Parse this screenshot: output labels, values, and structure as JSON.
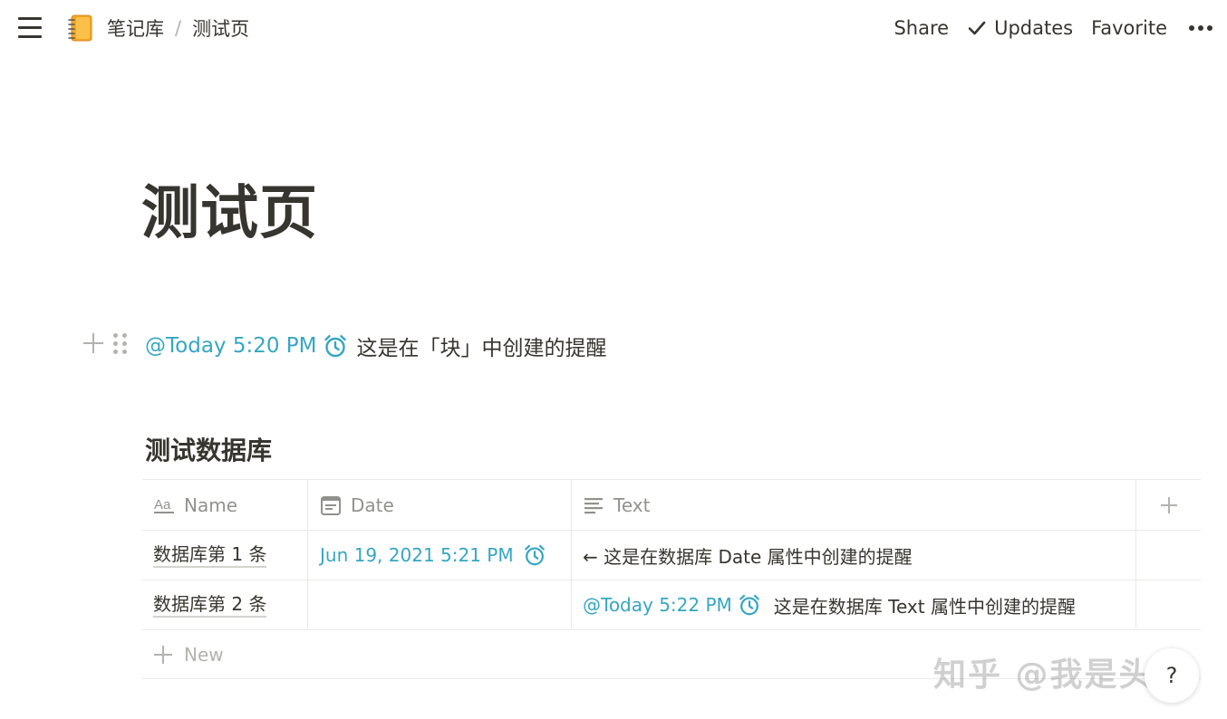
{
  "topbar": {
    "breadcrumb": [
      "笔记库",
      "测试页"
    ],
    "breadcrumb_separator": "/",
    "actions": {
      "share": "Share",
      "updates": "Updates",
      "favorite": "Favorite"
    }
  },
  "page": {
    "title": "测试页"
  },
  "block": {
    "mention": "@Today 5:20 PM",
    "text": "这是在「块」中创建的提醒"
  },
  "database": {
    "title": "测试数据库",
    "columns": {
      "name": "Name",
      "date": "Date",
      "text": "Text"
    },
    "rows": [
      {
        "name": "数据库第 1 条",
        "date": "Jun 19, 2021 5:21 PM",
        "text": "← 这是在数据库 Date 属性中创建的提醒"
      },
      {
        "name": "数据库第 2 条",
        "date": "",
        "text_mention": "@Today 5:22 PM",
        "text": "这是在数据库 Text 属性中创建的提醒"
      }
    ],
    "new_label": "New"
  },
  "help": {
    "label": "?"
  },
  "watermark": "知乎 @我是头哥",
  "colors": {
    "text": "#37352f",
    "mention": "#35a7c2",
    "muted": "#91918e",
    "border": "#e9e9e7"
  },
  "icons": {
    "menu": "hamburger-menu-icon",
    "notebook": "notebook-icon",
    "check": "check-icon",
    "more": "more-dots-icon",
    "alarm": "alarm-clock-icon",
    "name_col": "text-aa-icon",
    "date_col": "calendar-icon",
    "text_col": "text-lines-icon"
  }
}
